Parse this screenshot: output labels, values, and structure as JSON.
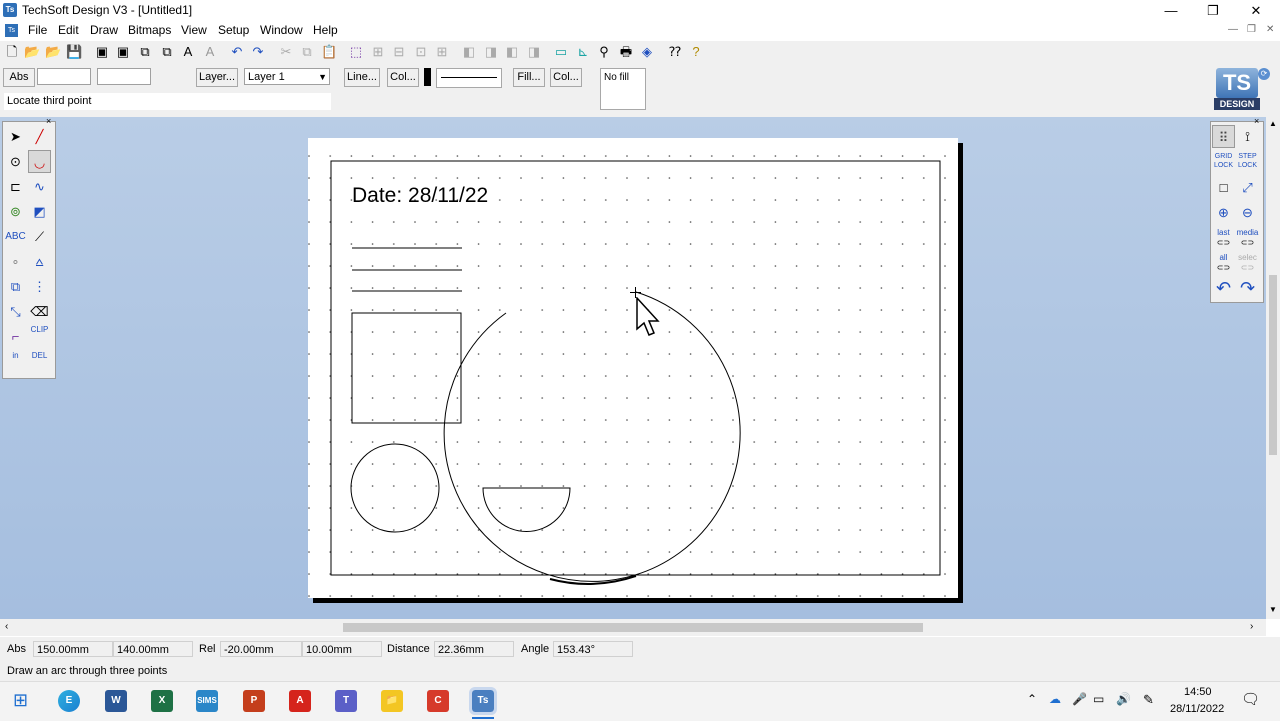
{
  "window": {
    "title": "TechSoft Design V3 - [Untitled1]",
    "minimize": "—",
    "restore": "❐",
    "close": "✕",
    "child_min": "—",
    "child_restore": "❐",
    "child_close": "✕"
  },
  "menu": [
    "File",
    "Edit",
    "Draw",
    "Bitmaps",
    "View",
    "Setup",
    "Window",
    "Help"
  ],
  "toolbar2": {
    "abs_label": "Abs",
    "coord_x": "",
    "coord_y": "",
    "layer_button": "Layer...",
    "layer_select": "Layer 1",
    "line_button": "Line...",
    "line_col_button": "Col...",
    "fill_button": "Fill...",
    "fill_col_button": "Col...",
    "fill_preview": "No fill",
    "prompt": "Locate third point"
  },
  "logo": {
    "ts": "TS",
    "design": "DESIGN"
  },
  "left_tools": {
    "abc": "ABC",
    "clip": "CLIP",
    "in": "in",
    "del": "DEL"
  },
  "right_tools": {
    "grid": "GRID",
    "grid_lock": "LOCK",
    "step": "STEP",
    "step_lock": "LOCK",
    "last": "last",
    "media": "media",
    "all": "all",
    "select": "selec"
  },
  "drawing": {
    "date_text": "Date: 28/11/22"
  },
  "status": {
    "abs_label": "Abs",
    "abs_x": "150.00mm",
    "abs_y": "140.00mm",
    "rel_label": "Rel",
    "rel_x": "-20.00mm",
    "rel_y": "10.00mm",
    "distance_label": "Distance",
    "distance": "22.36mm",
    "angle_label": "Angle",
    "angle": "153.43°",
    "hint": "Draw an arc through three points"
  },
  "taskbar": {
    "time": "14:50",
    "date": "28/11/2022",
    "apps": [
      "E",
      "W",
      "X",
      "SIMS",
      "P",
      "A",
      "T",
      "📁",
      "C",
      "Ts"
    ]
  },
  "colors": {
    "workspace": "#b3c9e4",
    "accent": "#2e6fb7"
  }
}
